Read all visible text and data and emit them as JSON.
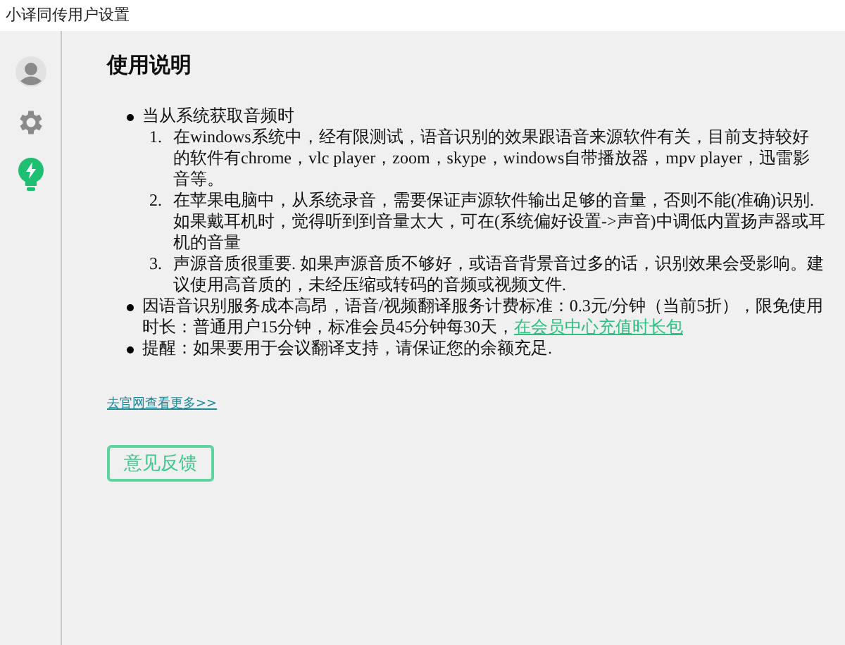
{
  "window": {
    "title": "小译同传用户设置"
  },
  "sidebar": {
    "items": [
      {
        "kind": "user",
        "selected": false
      },
      {
        "kind": "settings",
        "selected": false
      },
      {
        "kind": "tips",
        "selected": true
      }
    ]
  },
  "heading": "使用说明",
  "bullets": [
    {
      "text": "当从系统获取音频时",
      "children": [
        {
          "number": "1.",
          "text": "在windows系统中，经有限测试，语音识别的效果跟语音来源软件有关，目前支持较好的软件有chrome，vlc player，zoom，skype，windows自带播放器，mpv player，迅雷影音等。"
        },
        {
          "number": "2.",
          "text": "在苹果电脑中，从系统录音，需要保证声源软件输出足够的音量，否则不能(准确)识别. 如果戴耳机时，觉得听到到音量太大，可在(系统偏好设置->声音)中调低内置扬声器或耳机的音量"
        },
        {
          "number": "3.",
          "text": "声源音质很重要. 如果声源音质不够好，或语音背景音过多的话，识别效果会受影响。建议使用高音质的，未经压缩或转码的音频或视频文件."
        }
      ]
    },
    {
      "text": "因语音识别服务成本高昂，语音/视频翻译服务计费标准：0.3元/分钟（当前5折），限免使用时长：普通用户15分钟，标准会员45分钟每30天，",
      "link": "在会员中心充值时长包"
    },
    {
      "text": "提醒：如果要用于会议翻译支持，请保证您的余额充足."
    }
  ],
  "more_link": "去官网查看更多>>",
  "feedback_button": "意见反馈"
}
